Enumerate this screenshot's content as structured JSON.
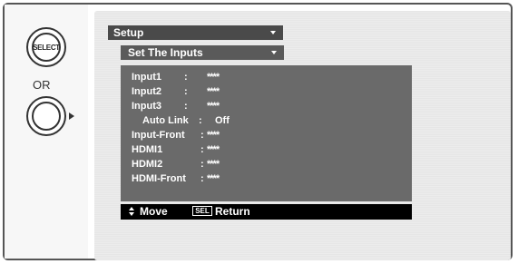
{
  "left_controls": {
    "select_button_label": "SELECT",
    "or_text": "OR"
  },
  "menu": {
    "title": "Setup",
    "submenu": "Set The Inputs",
    "items": [
      {
        "label": "Input1",
        "sep": ":",
        "value": "****"
      },
      {
        "label": "Input2",
        "sep": ":",
        "value": "****"
      },
      {
        "label": "Input3",
        "sep": ":",
        "value": "****"
      },
      {
        "label": "Auto Link",
        "sep": ":",
        "value": "Off"
      },
      {
        "label": "Input-Front",
        "sep": ":",
        "value": "****"
      },
      {
        "label": "HDMI1",
        "sep": ":",
        "value": "****"
      },
      {
        "label": "HDMI2",
        "sep": ":",
        "value": "****"
      },
      {
        "label": "HDMI-Front",
        "sep": ":",
        "value": "****"
      }
    ]
  },
  "footer": {
    "move_label": "Move",
    "sel_icon_text": "SEL",
    "return_label": "Return"
  },
  "icons": {
    "select_button": "select-circle-icon",
    "right_button": "right-arrow-circle-icon",
    "move": "up-down-arrow-icon"
  }
}
